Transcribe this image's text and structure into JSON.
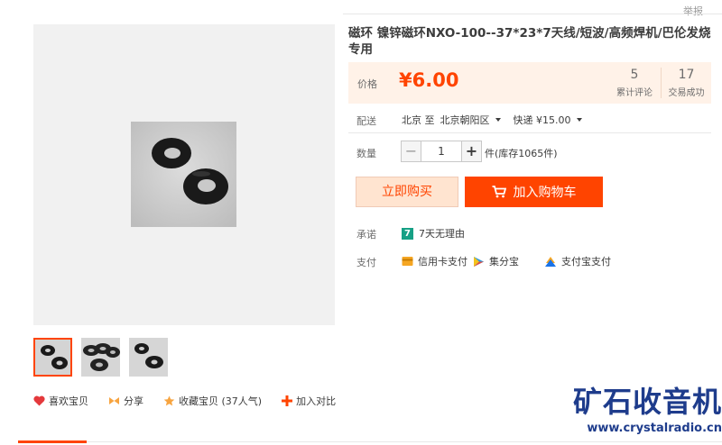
{
  "top": {
    "report": "举报"
  },
  "product": {
    "title": "磁环 镍锌磁环NXO-100--37*23*7天线/短波/高频焊机/巴伦发烧专用"
  },
  "price": {
    "label": "价格",
    "value": "¥6.00",
    "reviews_count": "5",
    "reviews_label": "累计评论",
    "deals_count": "17",
    "deals_label": "交易成功"
  },
  "shipping": {
    "label": "配送",
    "from": "北京 至",
    "to": "北京朝阳区",
    "method": "快递 ¥15.00"
  },
  "quantity": {
    "label": "数量",
    "value": "1",
    "stock": "件(库存1065件)",
    "minus": "−",
    "plus": "+"
  },
  "buttons": {
    "buy_now": "立即购买",
    "add_to_cart": "加入购物车"
  },
  "promise": {
    "label": "承诺",
    "icon_text": "7",
    "text": "7天无理由"
  },
  "payment": {
    "label": "支付",
    "methods": [
      "信用卡支付",
      "集分宝",
      "支付宝支付"
    ]
  },
  "actions": {
    "like": "喜欢宝贝",
    "share": "分享",
    "favorite": "收藏宝贝 (37人气)",
    "compare": "加入对比"
  },
  "watermark": {
    "brand": "矿石收音机",
    "url": "www.crystalradio.cn"
  },
  "colors": {
    "accent": "#ff4400",
    "price_bg": "#fff2e8",
    "watermark": "#1e3c8c"
  }
}
